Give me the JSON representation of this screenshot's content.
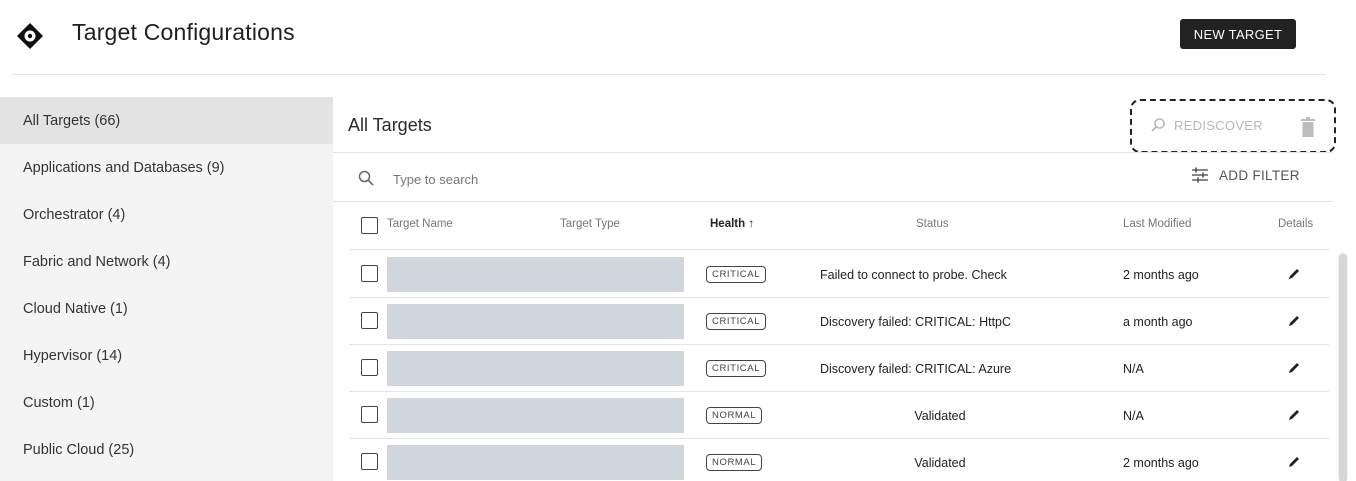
{
  "header": {
    "title": "Target Configurations",
    "logo_icon": "crosshair-diamond-icon",
    "new_target_label": "NEW TARGET"
  },
  "sidebar": {
    "items": [
      {
        "label": "All Targets (66)",
        "active": true
      },
      {
        "label": "Applications and Databases (9)"
      },
      {
        "label": "Orchestrator (4)"
      },
      {
        "label": "Fabric and Network (4)"
      },
      {
        "label": "Cloud Native (1)"
      },
      {
        "label": "Hypervisor (14)"
      },
      {
        "label": "Custom (1)"
      },
      {
        "label": "Public Cloud (25)"
      }
    ]
  },
  "main": {
    "title": "All Targets",
    "rediscover_label": "REDISCOVER",
    "search_placeholder": "Type to search",
    "add_filter_label": "ADD FILTER",
    "columns": {
      "name": "Target Name",
      "type": "Target Type",
      "health": "Health ↑",
      "status": "Status",
      "modified": "Last Modified",
      "details": "Details"
    },
    "rows": [
      {
        "health": "CRITICAL",
        "status": "Failed to connect to probe. Check",
        "modified": "2 months ago"
      },
      {
        "health": "CRITICAL",
        "status": "Discovery failed: CRITICAL: HttpC",
        "modified": "a month ago"
      },
      {
        "health": "CRITICAL",
        "status": "Discovery failed: CRITICAL: Azure",
        "modified": "N/A"
      },
      {
        "health": "NORMAL",
        "status": "Validated",
        "modified": "N/A"
      },
      {
        "health": "NORMAL",
        "status": "Validated",
        "modified": "2 months ago"
      }
    ]
  },
  "colors": {
    "primary_button": "#222222",
    "sidebar_bg": "#f4f4f4",
    "sidebar_active": "#e3e3e3",
    "name_placeholder": "#d1d6dc"
  }
}
